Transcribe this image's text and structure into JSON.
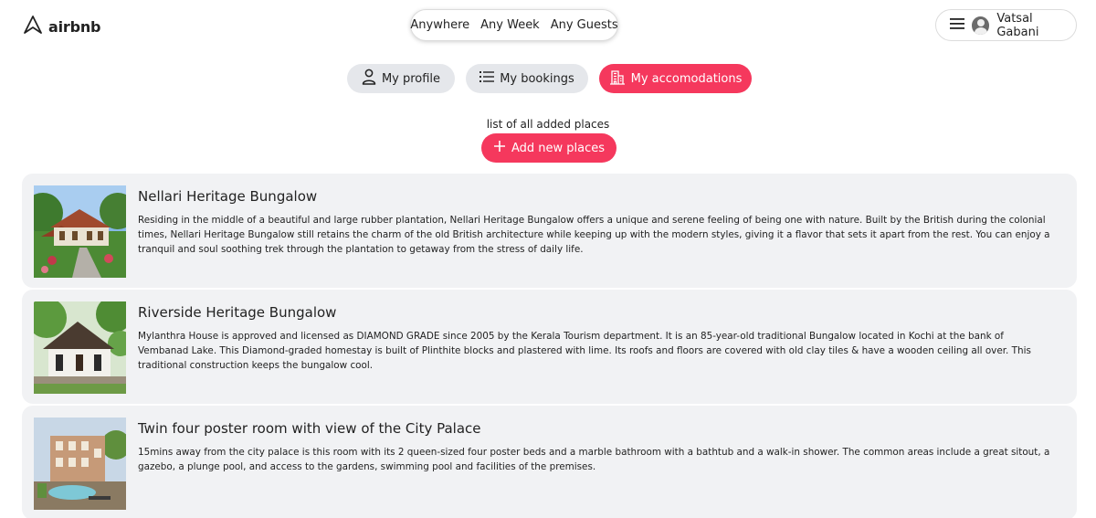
{
  "header": {
    "logo_text": "airbnb",
    "search": {
      "where": "Anywhere",
      "when": "Any Week",
      "who": "Any Guests"
    },
    "user": {
      "name": "Vatsal Gabani"
    }
  },
  "nav": {
    "profile": "My profile",
    "bookings": "My bookings",
    "accommodations": "My accomodations"
  },
  "page": {
    "subtitle": "list of all added places",
    "add_button": "Add new places"
  },
  "colors": {
    "accent": "#f5385d",
    "pill": "#e5e7eb",
    "card": "#f1f2f4"
  },
  "places": [
    {
      "title": "Nellari Heritage Bungalow",
      "description": "Residing in the middle of a beautiful and large rubber plantation, Nellari Heritage Bungalow offers a unique and serene feeling of being one with nature. Built by the British during the colonial times, Nellari Heritage Bungalow still retains the charm of the old British architecture while keeping up with the modern styles, giving it a flavor that sets it apart from the rest. You can enjoy a tranquil and soul soothing trek through the plantation to getaway from the stress of daily life."
    },
    {
      "title": "Riverside Heritage Bungalow",
      "description": "Mylanthra House is approved and licensed as DIAMOND GRADE since 2005 by the Kerala Tourism department. It is an 85-year-old traditional Bungalow located in Kochi at the bank of Vembanad Lake. This Diamond-graded homestay is built of Plinthite blocks and plastered with lime. Its roofs and floors are covered with old clay tiles & have a wooden ceiling all over. This traditional construction keeps the bungalow cool."
    },
    {
      "title": "Twin four poster room with view of the City Palace",
      "description": "15mins away from the city palace is this room with its 2 queen-sized four poster beds and a marble bathroom with a bathtub and a walk-in shower. The common areas include a great sitout, a gazebo, a plunge pool, and access to the gardens, swimming pool and facilities of the premises."
    }
  ]
}
